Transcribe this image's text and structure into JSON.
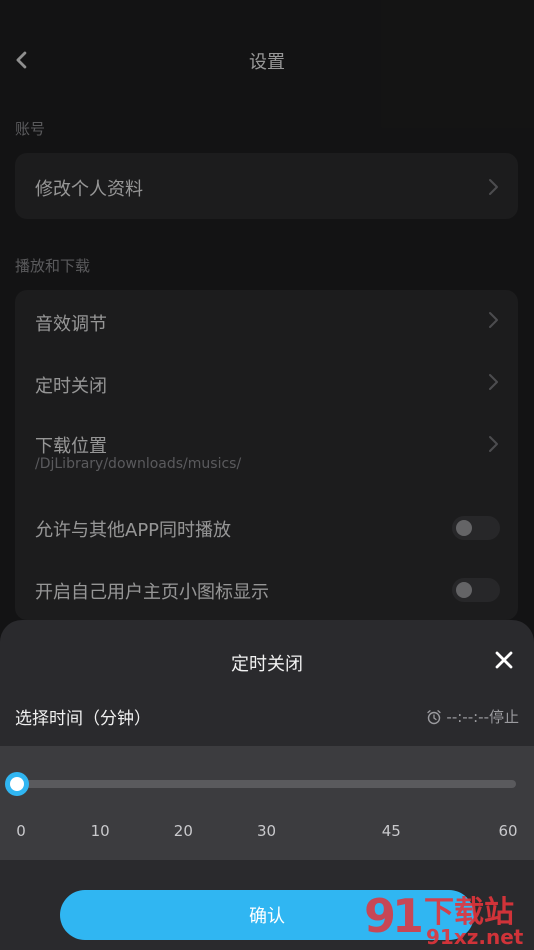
{
  "header": {
    "title": "设置"
  },
  "account": {
    "section_label": "账号",
    "items": [
      {
        "label": "修改个人资料"
      }
    ]
  },
  "playback": {
    "section_label": "播放和下载",
    "items": [
      {
        "label": "音效调节"
      },
      {
        "label": "定时关闭"
      },
      {
        "label": "下载位置",
        "sub": "/DjLibrary/downloads/musics/"
      },
      {
        "label": "允许与其他APP同时播放",
        "toggle": false
      },
      {
        "label": "开启自己用户主页小图标显示",
        "toggle": false
      }
    ]
  },
  "sheet": {
    "title": "定时关闭",
    "select_label": "选择时间（分钟）",
    "status": "--:--:--停止",
    "slider": {
      "value": 0,
      "min": 0,
      "max": 60,
      "ticks": [
        "0",
        "10",
        "20",
        "30",
        "45",
        "60"
      ],
      "tick_values": [
        0,
        10,
        20,
        30,
        45,
        60
      ]
    },
    "confirm_label": "确认"
  },
  "watermark": {
    "brand": "下载站",
    "domain": "91xz.net"
  },
  "colors": {
    "accent": "#30b6f2",
    "background": "#1e1e1f",
    "card": "#2b2b2d",
    "sheet": "#2a2a2d",
    "watermark": "#e2343b"
  }
}
